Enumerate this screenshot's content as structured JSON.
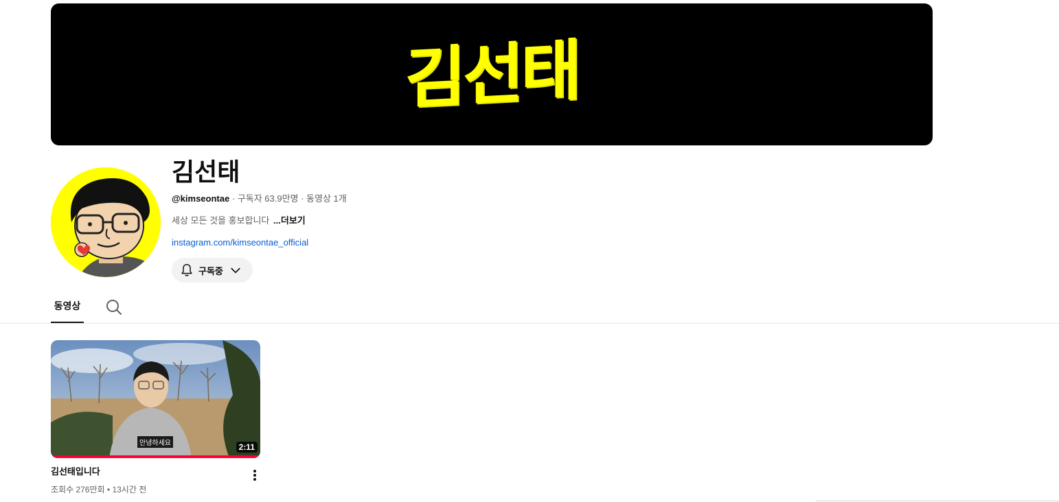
{
  "banner": {
    "logo_text": "김선태"
  },
  "channel": {
    "name": "김선태",
    "handle": "@kimseontae",
    "stats": " · 구독자 63.9만명 · 동영상 1개",
    "description": "세상 모든 것을 홍보합니다",
    "more_label": "...더보기",
    "link": "instagram.com/kimseontae_official"
  },
  "subscribe_button": {
    "label": "구독중"
  },
  "tabs": {
    "videos": "동영상"
  },
  "videos": [
    {
      "title": "김선태입니다",
      "duration": "2:11",
      "caption": "안녕하세요",
      "views": "조회수 276만회",
      "age": "13시간 전",
      "separator": " • ",
      "watched": 1.0
    }
  ],
  "colors": {
    "accent": "#ffff00",
    "progress": "#ff0033",
    "link": "#065fd4"
  }
}
